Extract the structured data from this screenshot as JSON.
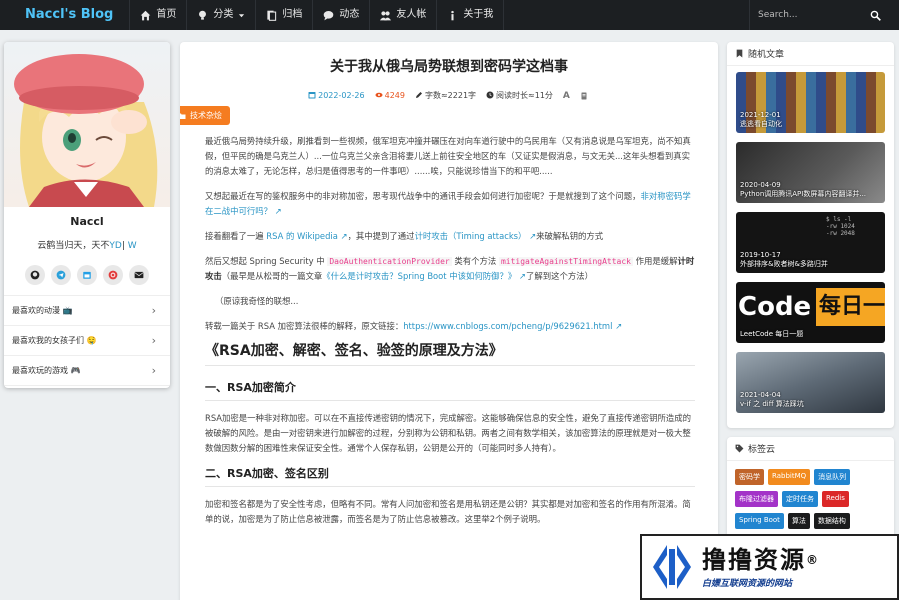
{
  "navbar": {
    "brand": "Naccl's Blog",
    "items": [
      {
        "label": "首页",
        "icon": "home-icon"
      },
      {
        "label": "分类",
        "icon": "bulb-icon"
      },
      {
        "label": "归档",
        "icon": "archive-icon"
      },
      {
        "label": "动态",
        "icon": "comment-icon"
      },
      {
        "label": "友人帐",
        "icon": "users-icon"
      },
      {
        "label": "关于我",
        "icon": "info-icon"
      }
    ],
    "search_placeholder": "Search..."
  },
  "profile": {
    "name": "Naccl",
    "bio": "云鹤当归天，天不",
    "bio_link": "YD",
    "bio_tail": "| ",
    "bio_link2": "W",
    "social": [
      "github-icon",
      "telegram-icon",
      "calendar-icon",
      "netease-music-icon",
      "email-icon"
    ],
    "favorites": [
      {
        "label": "最喜欢的动漫 📺"
      },
      {
        "label": "最喜欢我的女孩子们 🤤"
      },
      {
        "label": "最喜欢玩的游戏 🎮"
      }
    ]
  },
  "article": {
    "title": "关于我从俄乌局势联想到密码学这档事",
    "date": "2022-02-26",
    "views": "4249",
    "words": "字数≈2221字",
    "read_time": "阅读时长≈11分",
    "font_label": "A",
    "category": "技术杂烩",
    "p1": "最近俄乌局势持续升级，刷推看到一些视频，俄军坦克冲撞并碾压在对向车道行驶中的乌民用车（又有消息说是乌军坦克，尚不知真假，但平民的确是乌克兰人）...一位乌克兰父亲含泪将妻儿送上前往安全地区的车（又证实是假消息，与文无关...这年头想看到真实的消息太难了，无论怎样，总归是值得思考的一件事吧）......唉，只能说珍惜当下的和平吧.....",
    "p2_a": "又想起最近在写的鉴权服务中的非对称加密，思考现代战争中的通讯手段会如何进行加密呢？于是就搜到了这个问题，",
    "p2_link": "非对称密码学在二战中可行吗？",
    "p3_a": "接着翻看了一遍 ",
    "p3_link1": "RSA 的 Wikipedia",
    "p3_b": "，其中提到了通过",
    "p3_link2": "计时攻击（Timing attacks）",
    "p3_c": "来破解私钥的方式",
    "p4_a": "然后又想起 Spring Security 中 ",
    "p4_code1": "DaoAuthenticationProvider",
    "p4_b": " 类有个方法 ",
    "p4_code2": "mitigateAgainstTimingAttack",
    "p4_c": " 作用是缓解",
    "p4_bold": "计时攻击",
    "p4_d": "（最早是从松哥的一篇文章",
    "p4_link": "《什么是计时攻击？Spring Boot 中该如何防御？》",
    "p4_e": "了解到这个方法）",
    "p5": "（原谅我奇怪的联想...",
    "p6_a": "转载一篇关于 RSA 加密算法很棒的解释，原文链接：",
    "p6_link": "https://www.cnblogs.com/pcheng/p/9629621.html",
    "h1": "《RSA加密、解密、签名、验签的原理及方法》",
    "h2a": "一、RSA加密简介",
    "p7": "RSA加密是一种非对称加密。可以在不直接传递密钥的情况下，完成解密。这能够确保信息的安全性，避免了直接传递密钥所造成的被破解的风险。是由一对密钥来进行加解密的过程，分别称为公钥和私钥。两者之间有数学相关，该加密算法的原理就是对一极大整数做因数分解的困难性来保证安全性。通常个人保存私钥，公钥是公开的（可能同时多人持有）。",
    "h2b": "二、RSA加密、签名区别",
    "p8": "加密和签名都是为了安全性考虑，但略有不同。常有人问加密和签名是用私钥还是公钥？其实都是对加密和签名的作用有所混淆。简单的说，加密是为了防止信息被泄露，而签名是为了防止信息被篡改。这里举2个例子说明。"
  },
  "random_articles": {
    "title": "随机文章",
    "items": [
      {
        "date": "2021-12-01",
        "title": "逃逃看自动化"
      },
      {
        "date": "2020-04-09",
        "title": "Python调用腾讯API数屏幕内容翻译并..."
      },
      {
        "date": "2019-10-17",
        "title": "外部排序&败者树&多路归并"
      },
      {
        "date": "",
        "title": "LeetCode 每日一题",
        "big_left": "Code",
        "big_right": "每日一"
      },
      {
        "date": "2021-04-04",
        "title": "v-if 之 diff 算法踩坑"
      }
    ]
  },
  "tag_cloud": {
    "title": "标签云",
    "tags": [
      {
        "label": "密码学",
        "color": "#c0642a"
      },
      {
        "label": "RabbitMQ",
        "color": "#f28b1e"
      },
      {
        "label": "消息队列",
        "color": "#2185d0"
      },
      {
        "label": "布隆过滤器",
        "color": "#a333c8"
      },
      {
        "label": "定时任务",
        "color": "#2185d0"
      },
      {
        "label": "Redis",
        "color": "#db2828"
      },
      {
        "label": "Spring Boot",
        "color": "#2185d0"
      },
      {
        "label": "算法",
        "color": "#1b1c1d"
      },
      {
        "label": "数据结构",
        "color": "#1b1c1d"
      }
    ]
  },
  "watermark": {
    "title": "撸撸资源",
    "reg": "®",
    "subtitle": "白嫖互联网资源的网站"
  },
  "colors": {
    "navbar_bg": "#1c1f22",
    "brand": "#4fc3f7",
    "link": "#2a95c5",
    "accent_orange": "#f57c20",
    "views": "#e8541e"
  }
}
